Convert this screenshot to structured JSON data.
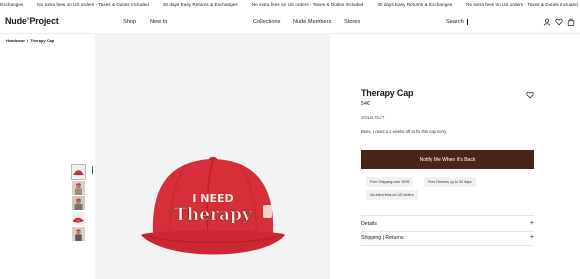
{
  "ticker": {
    "items": [
      "s & Exchanges",
      "No extra fees on US orders - Taxes & Duties Included",
      "30 days Easy Returns & Exchanges",
      "No extra fees on US orders - Taxes & Duties Included",
      "30 days Easy Returns & Exchanges",
      "No extra fees on US orders - Taxes & Duties Included",
      "30 days Easy Returns & Exchanges",
      "No extra fees on US orders - Taxes & Duties Included 1 i"
    ]
  },
  "header": {
    "logo": "Nude",
    "logo_mark": "®",
    "logo_suffix": "Project",
    "nav": {
      "shop": "Shop",
      "new_in": "New In",
      "collections": "Collections",
      "members": "Nude Members",
      "stores": "Stores"
    },
    "search_label": "Search",
    "icons": [
      "user-icon",
      "heart-icon",
      "bag-icon"
    ]
  },
  "breadcrumb": {
    "parent": "Headwear",
    "sep": "/",
    "current": "Therapy Cap"
  },
  "gallery": {
    "thumb_count": 5,
    "cap_text_line1": "I NEED",
    "cap_text_line2": "Therapy",
    "colors": {
      "cap": "#d62f3a",
      "cap_shade": "#b81f2c",
      "text": "#f4e7dc"
    }
  },
  "product": {
    "title": "Therapy Cap",
    "price": "54€",
    "stock": "SOLD OUT",
    "description": "Bees, I need a 2 weeks off to fix this cap sorry.",
    "notify_label": "Notify Me When It's Back",
    "perks": [
      "Free Shipping over 300€",
      "Free Returns up to 30 days",
      "No extra fees on US orders"
    ],
    "accordion": [
      "Details",
      "Shipping | Returns"
    ],
    "accent": "#4a2417"
  }
}
